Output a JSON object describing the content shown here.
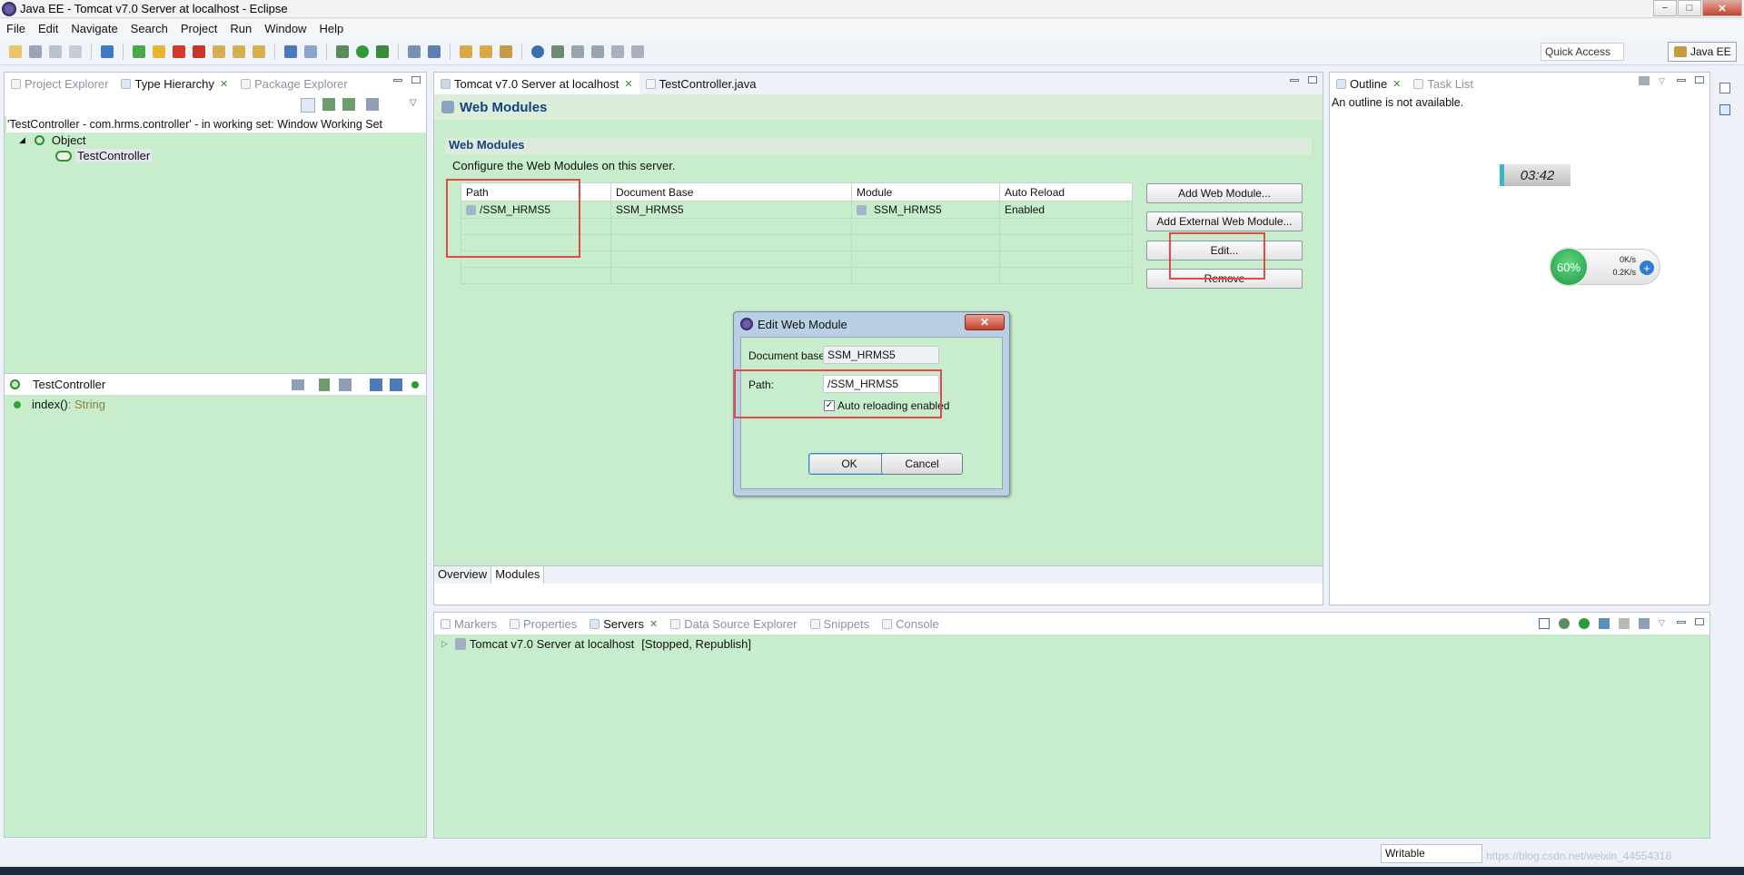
{
  "window": {
    "title": "Java EE - Tomcat v7.0 Server at localhost - Eclipse",
    "buttons": [
      "−",
      "□",
      "✕"
    ]
  },
  "menu": [
    "File",
    "Edit",
    "Navigate",
    "Search",
    "Project",
    "Run",
    "Window",
    "Help"
  ],
  "toolbar": {
    "quick_access": "Quick Access",
    "perspective": "Java EE"
  },
  "left_tabs": [
    {
      "label": "Project Explorer",
      "active": false
    },
    {
      "label": "Type Hierarchy",
      "active": true
    },
    {
      "label": "Package Explorer",
      "active": false
    }
  ],
  "hierarchy": {
    "info": "'TestController - com.hrms.controller' - in working set: Window Working Set",
    "root": "Object",
    "child": "TestController"
  },
  "members": {
    "title": "TestController",
    "method_name": "index()",
    "method_type": " : String"
  },
  "editor_tabs": [
    {
      "label": "Tomcat v7.0 Server at localhost",
      "active": true
    },
    {
      "label": "TestController.java",
      "active": false
    }
  ],
  "editor": {
    "title": "Web Modules",
    "section": "Web Modules",
    "description": "Configure the Web Modules on this server.",
    "columns": [
      "Path",
      "Document Base",
      "Module",
      "Auto Reload"
    ],
    "row": {
      "path": "/SSM_HRMS5",
      "document_base": "SSM_HRMS5",
      "module": "SSM_HRMS5",
      "auto_reload": "Enabled"
    },
    "buttons": [
      "Add Web Module...",
      "Add External Web Module...",
      "Edit...",
      "Remove"
    ],
    "bottom_tabs": [
      "Overview",
      "Modules"
    ]
  },
  "dialog": {
    "title": "Edit Web Module",
    "doc_base_label": "Document base:",
    "doc_base_value": "SSM_HRMS5",
    "path_label": "Path:",
    "path_value": "/SSM_HRMS5",
    "auto_reload_label": "Auto reloading enabled",
    "auto_reload_checked": true,
    "ok": "OK",
    "cancel": "Cancel"
  },
  "right_tabs": [
    {
      "label": "Outline",
      "active": true
    },
    {
      "label": "Task List",
      "active": false
    }
  ],
  "outline": {
    "message": "An outline is not available.",
    "clock": "03:42"
  },
  "net_widget": {
    "percent": "60%",
    "up": "0K/s",
    "down": "0.2K/s"
  },
  "bottom_tabs": [
    {
      "label": "Markers",
      "active": false
    },
    {
      "label": "Properties",
      "active": false
    },
    {
      "label": "Servers",
      "active": true
    },
    {
      "label": "Data Source Explorer",
      "active": false
    },
    {
      "label": "Snippets",
      "active": false
    },
    {
      "label": "Console",
      "active": false
    }
  ],
  "servers": {
    "entry": "Tomcat v7.0 Server at localhost",
    "state": "[Stopped, Republish]"
  },
  "status": {
    "writable": "Writable",
    "watermark": "https://blog.csdn.net/weixin_44554318"
  },
  "colors": {
    "pane_bg": "#c7edcc",
    "highlight": "#e24a4a",
    "accent": "#16407f"
  }
}
